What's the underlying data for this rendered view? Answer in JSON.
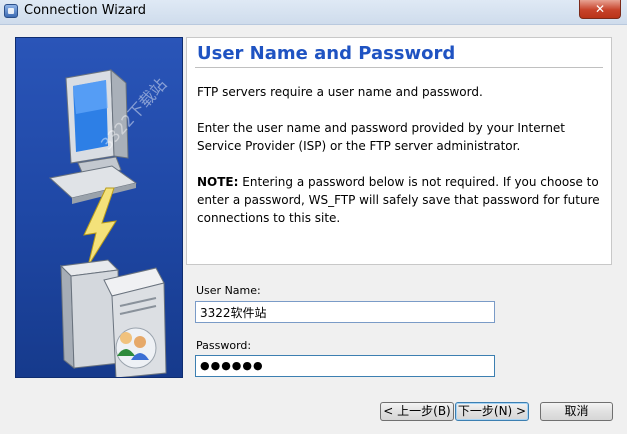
{
  "window": {
    "title": "Connection Wizard",
    "close_label": "✕"
  },
  "main": {
    "heading": "User Name and Password",
    "paragraph1": "FTP servers require a user name and password.",
    "paragraph2": "Enter the user name and password provided by your Internet Service Provider (ISP) or the FTP server administrator.",
    "note_label": "NOTE:",
    "note_text": " Entering a password below is not required. If you choose to enter a password, WS_FTP will safely save that password for future connections to this site."
  },
  "form": {
    "username_label": "User Name:",
    "username_value": "3322软件站",
    "password_label": "Password:",
    "password_value": "●●●●●●"
  },
  "buttons": {
    "back": "< 上一步(B)",
    "next": "下一步(N) >",
    "cancel": "取消"
  },
  "watermarks": {
    "top": "3322下载站",
    "bottom": "3322下载站"
  },
  "colors": {
    "heading": "#1f53c2",
    "panel_blue": "#1f48a6",
    "close_red": "#c7422a"
  }
}
